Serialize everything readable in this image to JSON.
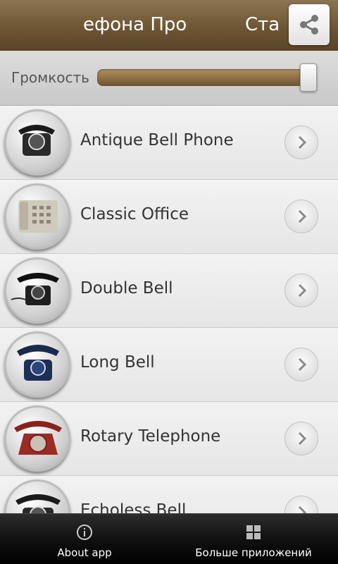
{
  "header": {
    "title_left": "ефона Про",
    "title_right": "Ста",
    "share_icon": "share-icon"
  },
  "volume": {
    "label": "Громкость",
    "level": 1.0
  },
  "list": {
    "items": [
      {
        "name": "Antique Bell Phone",
        "icon": "antique-phone-icon",
        "color": "#2a2a2a"
      },
      {
        "name": "Classic Office",
        "icon": "office-phone-icon",
        "color": "#cfcabc"
      },
      {
        "name": "Double Bell",
        "icon": "double-bell-phone-icon",
        "color": "#1f1f1f"
      },
      {
        "name": "Long Bell",
        "icon": "long-bell-phone-icon",
        "color": "#1e2f55"
      },
      {
        "name": "Rotary Telephone",
        "icon": "rotary-phone-icon",
        "color": "#9b2b25"
      },
      {
        "name": "Echoless Bell",
        "icon": "echoless-phone-icon",
        "color": "#2a2a2a"
      }
    ]
  },
  "bottom_bar": {
    "about_label": "About app",
    "more_label": "Больше приложений"
  }
}
